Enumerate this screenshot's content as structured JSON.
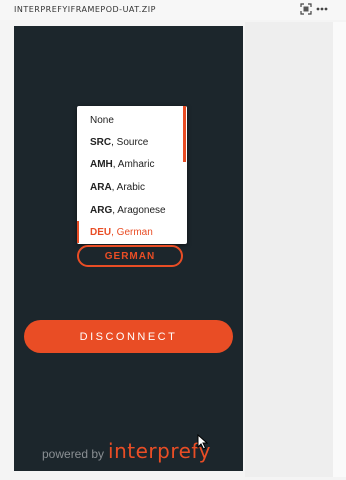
{
  "viewer": {
    "filename": "INTERPREFYIFRAMEPOD-UAT.ZIP",
    "expand_icon": "expand-icon",
    "more_icon": "more-icon"
  },
  "language_dropdown": {
    "options": [
      {
        "code": "",
        "name": "None"
      },
      {
        "code": "SRC",
        "name": ", Source"
      },
      {
        "code": "AMH",
        "name": ", Amharic"
      },
      {
        "code": "ARA",
        "name": ", Arabic"
      },
      {
        "code": "ARG",
        "name": ", Aragonese"
      },
      {
        "code": "DEU",
        "name": ", German"
      }
    ],
    "selected_index": 5
  },
  "selected_language": "GERMAN",
  "disconnect_label": "DISCONNECT",
  "footer": {
    "powered_by": "powered by",
    "brand": "interprefy"
  },
  "colors": {
    "accent": "#e94d25",
    "app_background": "#1c262c"
  }
}
